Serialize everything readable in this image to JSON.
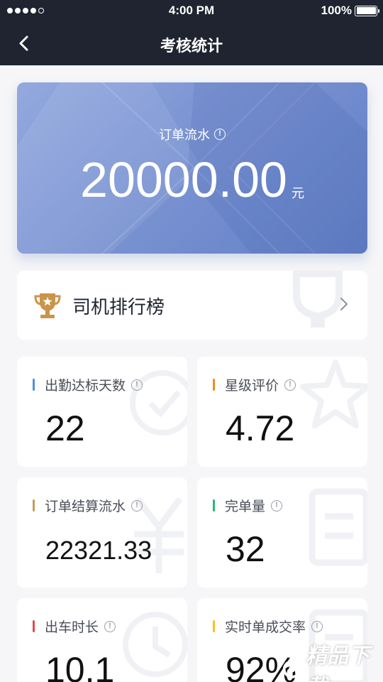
{
  "status_bar": {
    "time": "4:00 PM",
    "battery": "100%"
  },
  "nav": {
    "title": "考核统计",
    "back_icon": "chevron-left-icon"
  },
  "hero": {
    "label": "订单流水",
    "value": "20000.00",
    "unit": "元",
    "info_icon": "!"
  },
  "ranking": {
    "title": "司机排行榜",
    "icon": "trophy-icon",
    "arrow_icon": "chevron-right-icon"
  },
  "stats": [
    {
      "label": "出勤达标天数",
      "value": "22",
      "accent": "#4a90e2"
    },
    {
      "label": "星级评价",
      "value": "4.72",
      "accent": "#f08a24"
    },
    {
      "label": "订单结算流水",
      "value": "22321.33",
      "accent": "#c89a5a"
    },
    {
      "label": "完单量",
      "value": "32",
      "accent": "#2bb673"
    },
    {
      "label": "出车时长",
      "value": "10.1",
      "accent": "#e54848"
    },
    {
      "label": "实时单成交率",
      "value": "92%",
      "accent": "#f5c518"
    }
  ],
  "info_mark": "!",
  "watermark": "精品下载"
}
